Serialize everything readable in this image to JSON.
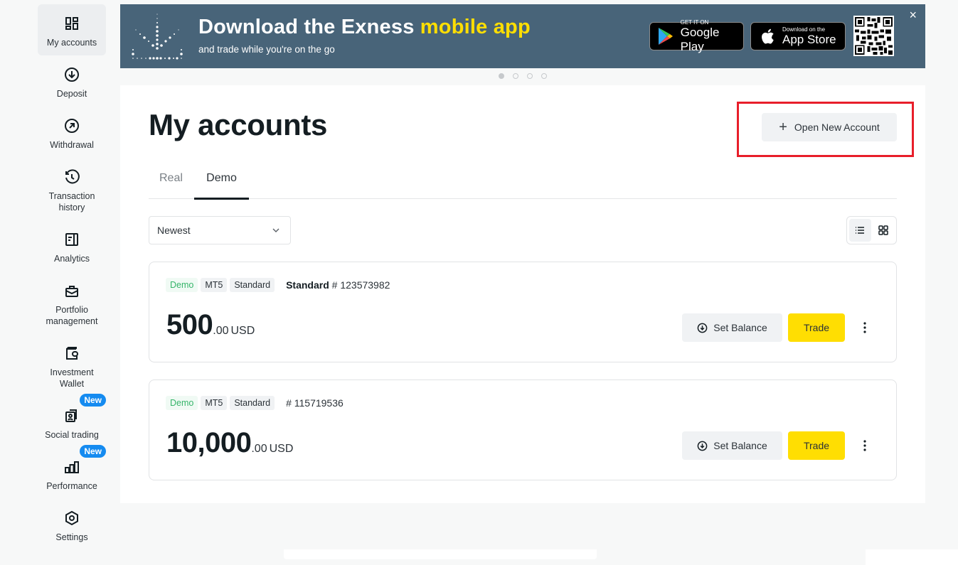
{
  "sidebar": {
    "items": [
      {
        "label": "My accounts",
        "icon": "dashboard-grid-icon",
        "active": true
      },
      {
        "label": "Deposit",
        "icon": "arrow-down-circle-icon"
      },
      {
        "label": "Withdrawal",
        "icon": "arrow-up-right-circle-icon"
      },
      {
        "label": "Transaction history",
        "icon": "history-icon"
      },
      {
        "label": "Analytics",
        "icon": "document-analytics-icon"
      },
      {
        "label": "Portfolio management",
        "icon": "briefcase-icon"
      },
      {
        "label": "Investment Wallet",
        "icon": "wallet-icon"
      },
      {
        "label": "Social trading",
        "icon": "social-trading-icon",
        "badge": "New"
      },
      {
        "label": "Performance",
        "icon": "bar-chart-icon",
        "badge": "New"
      },
      {
        "label": "Settings",
        "icon": "settings-hexagon-icon"
      }
    ]
  },
  "banner": {
    "title_prefix": "Download the Exness ",
    "title_highlight": "mobile app",
    "subtitle": "and trade while you're on the go",
    "google_play": {
      "small": "GET IT ON",
      "big": "Google Play"
    },
    "app_store": {
      "small": "Download on the",
      "big": "App Store"
    },
    "close_label": "×",
    "slides_total": 4,
    "slide_active": 1,
    "colors": {
      "background": "#486479",
      "highlight": "#ffde02"
    }
  },
  "main": {
    "title": "My accounts",
    "open_account_label": "Open New Account",
    "tabs": [
      {
        "label": "Real",
        "active": false
      },
      {
        "label": "Demo",
        "active": true
      }
    ],
    "sort": {
      "selected": "Newest"
    },
    "view_modes": [
      {
        "name": "list",
        "active": true
      },
      {
        "name": "grid",
        "active": false
      }
    ],
    "accounts": [
      {
        "chips": [
          "Demo",
          "MT5",
          "Standard"
        ],
        "name": "Standard",
        "number": "# 123573982",
        "balance_int": "500",
        "balance_dec": ".00",
        "currency": "USD",
        "set_balance_label": "Set Balance",
        "trade_label": "Trade"
      },
      {
        "chips": [
          "Demo",
          "MT5",
          "Standard"
        ],
        "name": "",
        "number": "# 115719536",
        "balance_int": "10,000",
        "balance_dec": ".00",
        "currency": "USD",
        "set_balance_label": "Set Balance",
        "trade_label": "Trade"
      }
    ],
    "colors": {
      "trade_button": "#ffde02",
      "demo_chip_text": "#36b56a",
      "highlight_box": "#e81e2a",
      "badge": "#158bf0"
    }
  }
}
